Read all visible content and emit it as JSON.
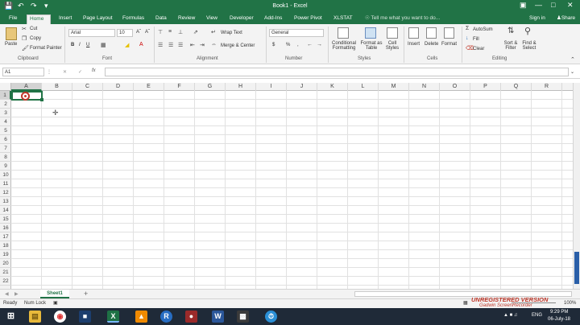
{
  "window": {
    "title": "Book1 - Excel"
  },
  "tabs": [
    "File",
    "Home",
    "Insert",
    "Page Layout",
    "Formulas",
    "Data",
    "Review",
    "View",
    "Developer",
    "Add-Ins",
    "Power Pivot",
    "XLSTAT"
  ],
  "tell_me": "Tell me what you want to do...",
  "signin": "Sign in",
  "share": "Share",
  "clipboard": {
    "paste": "Paste",
    "cut": "Cut",
    "copy": "Copy",
    "format_painter": "Format Painter",
    "label": "Clipboard"
  },
  "font": {
    "name": "Arial",
    "size": "10",
    "bold": "B",
    "italic": "I",
    "underline": "U",
    "label": "Font"
  },
  "alignment": {
    "wrap": "Wrap Text",
    "merge": "Merge & Center",
    "label": "Alignment"
  },
  "number": {
    "format": "General",
    "currency": "$",
    "percent": "%",
    "comma": ",",
    "label": "Number"
  },
  "styles": {
    "conditional": "Conditional Formatting",
    "format_table": "Format as Table",
    "cell_styles": "Cell Styles",
    "label": "Styles"
  },
  "cells": {
    "insert": "Insert",
    "delete": "Delete",
    "format": "Format",
    "label": "Cells"
  },
  "editing": {
    "autosum": "AutoSum",
    "fill": "Fill",
    "clear": "Clear",
    "sort": "Sort & Filter",
    "find": "Find & Select",
    "label": "Editing"
  },
  "namebox": "A1",
  "fx": "fx",
  "columns": [
    "A",
    "B",
    "C",
    "D",
    "E",
    "F",
    "G",
    "H",
    "I",
    "J",
    "K",
    "L",
    "M",
    "N",
    "O",
    "P",
    "Q",
    "R"
  ],
  "rows": [
    "1",
    "2",
    "3",
    "4",
    "5",
    "6",
    "7",
    "8",
    "9",
    "10",
    "11",
    "12",
    "13",
    "14",
    "15",
    "16",
    "17",
    "18",
    "19",
    "20",
    "21",
    "22"
  ],
  "sheet": {
    "name": "Sheet1",
    "add": "+"
  },
  "status": {
    "ready": "Ready",
    "numlock": "Num Lock",
    "zoom": "100%"
  },
  "watermark": {
    "line1": "UNREGISTERED VERSION",
    "line2": "Gadwin ScreenRecorder"
  },
  "clock": {
    "time": "9:29 PM",
    "date": "06-July-18"
  },
  "lang": "ENG"
}
